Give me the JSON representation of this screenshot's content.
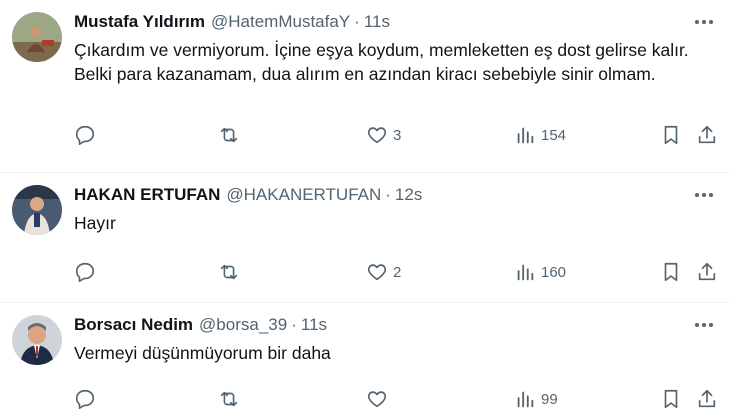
{
  "tweets": [
    {
      "name": "Mustafa Yıldırım",
      "handle": "@HatemMustafaY",
      "separator": "·",
      "time": "11s",
      "text": "Çıkardım ve vermiyorum. İçine eşya koydum, memleketten eş dost gelirse kalır. Belki para kazanamam, dua alırım en azından kiracı sebebiyle sinir olmam.",
      "likes": "3",
      "views": "154",
      "avatar_colors": {
        "bg": "#8b9a7a",
        "accent": "#6b4a2f"
      }
    },
    {
      "name": "HAKAN ERTUFAN",
      "handle": "@HAKANERTUFAN",
      "separator": "·",
      "time": "12s",
      "text": "Hayır",
      "likes": "2",
      "views": "160",
      "avatar_colors": {
        "bg": "#3a4a5e",
        "accent": "#e8e2d8"
      }
    },
    {
      "name": "Borsacı Nedim",
      "handle": "@borsa_39",
      "separator": "·",
      "time": "11s",
      "text": "Vermeyi düşünmüyorum bir daha",
      "likes": "",
      "views": "99",
      "avatar_colors": {
        "bg": "#c8ccd4",
        "accent": "#1f2a44"
      }
    }
  ],
  "theme": {
    "text": "#0f1419",
    "muted": "#536471",
    "divider": "#eff3f4"
  }
}
